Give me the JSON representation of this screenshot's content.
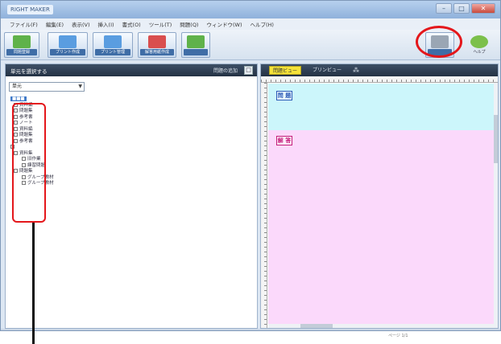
{
  "window": {
    "title": "RIGHT MAKER"
  },
  "menu": [
    "ファイル(F)",
    "編集(E)",
    "表示(V)",
    "挿入(I)",
    "書式(O)",
    "ツール(T)",
    "問題(Q)",
    "ウィンドウ(W)",
    "ヘルプ(H)"
  ],
  "toolbar": {
    "buttons": [
      {
        "label": "問題登録",
        "color": "#5fb24a"
      },
      {
        "label": "プリント作成",
        "color": "#5a9de0"
      },
      {
        "label": "プリント管理",
        "color": "#5a9de0"
      },
      {
        "label": "解答用紙作成",
        "color": "#d94e4e"
      },
      {
        "label": "",
        "color": "#5fb24a"
      },
      {
        "label": "",
        "color": "#9aa6b4"
      },
      {
        "label": "ヘルプ",
        "color": "#7cc04b"
      }
    ]
  },
  "left_panel": {
    "title": "単元を選択する",
    "header_right": "問題の追加",
    "header_button": "□",
    "select_value": "単元",
    "tree": [
      {
        "label": "■■■",
        "selected": true
      },
      {
        "label": "資料編"
      },
      {
        "label": "問題集"
      },
      {
        "label": "参考書"
      },
      {
        "label": "ノート"
      },
      {
        "label": "資料編"
      },
      {
        "label": "問題集"
      },
      {
        "label": "参考書"
      },
      {
        "label": ""
      },
      {
        "label": "資料集"
      },
      {
        "label": "旧作業"
      },
      {
        "label": "練習問題"
      },
      {
        "label": "問題集"
      },
      {
        "label": "グループ教材"
      },
      {
        "label": "グループ教材"
      }
    ]
  },
  "right_panel": {
    "tab_active": "問題ビュー",
    "tab_other": "プリンビュー",
    "question_label": "問 題",
    "answer_label": "解 答"
  },
  "status": {
    "text": "ページ  1/1"
  }
}
